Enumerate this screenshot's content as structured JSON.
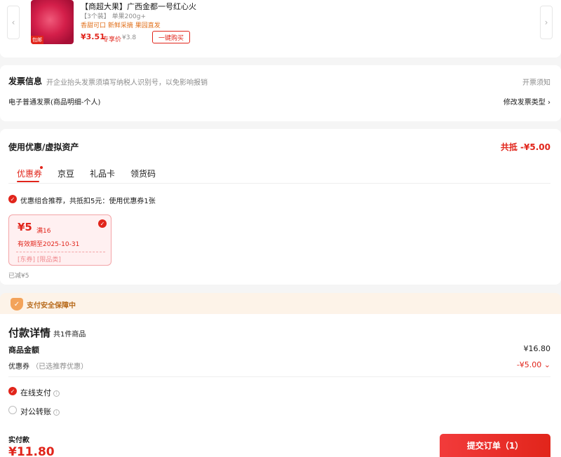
{
  "product": {
    "title": "【商超大果】广西金都一号红心火",
    "spec_count": "【3个装】",
    "spec_weight": "单果200g+",
    "tags": "香甜可口 新鲜采摘 果园直发",
    "price": "¥3.51",
    "vip_label": "专享价",
    "orig_price": "¥3.8",
    "thumb_tag": "包邮",
    "buy_label": "一键购买",
    "prev_arrow": "‹",
    "next_arrow": "›"
  },
  "invoice": {
    "title": "发票信息",
    "hint": "开企业抬头发票须填写纳税人识别号，以免影响报销",
    "notice_link": "开票须知",
    "type_text": "电子普通发票(商品明细-个人)",
    "modify_link": "修改发票类型"
  },
  "coupon_section": {
    "title": "使用优惠/虚拟资产",
    "total_discount": "共抵 -¥5.00",
    "tabs": [
      "优惠券",
      "京豆",
      "礼品卡",
      "领货码"
    ],
    "recommend": "优惠组合推荐，共抵扣5元：使用优惠券1张",
    "coupon": {
      "amount": "¥5",
      "condition": "满16",
      "expiry": "有效期至2025-10-31",
      "tags": "[东券] [限品类]"
    },
    "reduced": "已减¥5"
  },
  "security": {
    "text": "支付安全保障中"
  },
  "payment": {
    "title": "付款详情",
    "item_count": "共1件商品",
    "goods_label": "商品金额",
    "goods_value": "¥16.80",
    "coupon_label": "优惠券",
    "coupon_note": "（已选推荐优惠）",
    "coupon_value": "-¥5.00",
    "options": [
      "在线支付",
      "对公转账"
    ],
    "actual_label": "实付款",
    "actual_amount": "¥11.80",
    "submit_label": "提交订单（1）"
  },
  "colors": {
    "accent": "#e1251b",
    "security_bg": "#fdf3e8"
  }
}
